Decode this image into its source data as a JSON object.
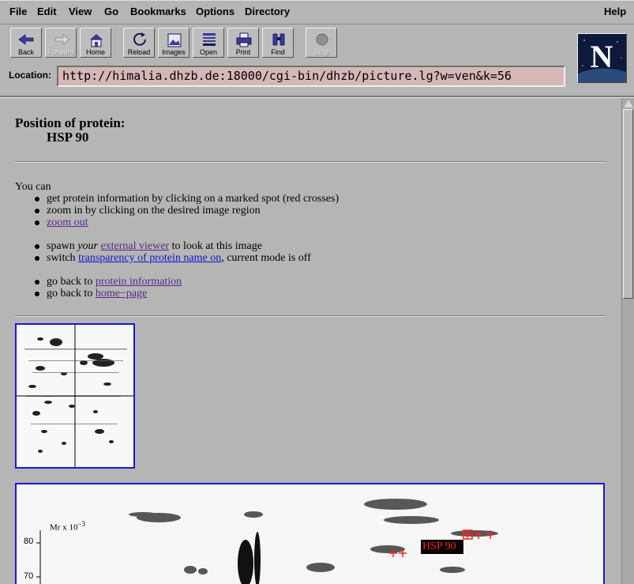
{
  "menu": {
    "file": "File",
    "edit": "Edit",
    "view": "View",
    "go": "Go",
    "bookmarks": "Bookmarks",
    "options": "Options",
    "directory": "Directory",
    "help": "Help"
  },
  "toolbar": {
    "back": "Back",
    "forward": "Forward",
    "home": "Home",
    "reload": "Reload",
    "images": "Images",
    "open": "Open",
    "print": "Print",
    "find": "Find",
    "stop": "Stop"
  },
  "location": {
    "label": "Location:",
    "url": "http://himalia.dhzb.de:18000/cgi-bin/dhzb/picture.lg?w=ven&k=56"
  },
  "page": {
    "title": "Position of protein:",
    "protein": "HSP 90",
    "intro": "You can",
    "opt1": "get protein information by clicking on a marked spot (red crosses)",
    "opt2": "zoom in by clicking on the desired image region",
    "opt3_link": "zoom out",
    "opt4_pre": "spawn ",
    "opt4_em": "your",
    "opt4_link": "external viewer",
    "opt4_post": " to look at this image",
    "opt5_pre": "switch ",
    "opt5_link": "transparency of protein name on",
    "opt5_post": ", current mode is off",
    "opt6_pre": "go back to ",
    "opt6_link": "protein information",
    "opt7_pre": "go back to ",
    "opt7_link": "home−page"
  },
  "gel": {
    "axis_unit": "Mr x 10",
    "axis_exp": "−3",
    "tick_80": "80",
    "tick_70": "70",
    "label": "HSP 90"
  },
  "colors": {
    "link_visited": "#5a2a8a",
    "link_unvisited": "#1515c8",
    "image_border": "#1818d8",
    "marker": "#ff2020"
  }
}
